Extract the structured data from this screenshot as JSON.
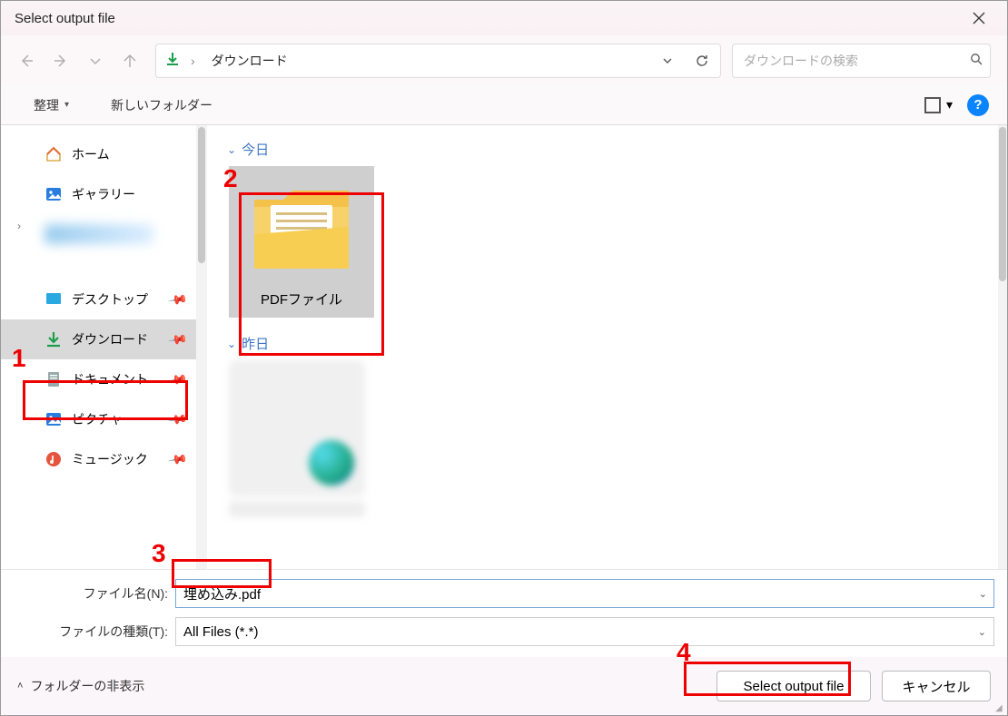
{
  "title": "Select output file",
  "nav": {
    "crumb": "ダウンロード"
  },
  "search": {
    "placeholder": "ダウンロードの検索"
  },
  "toolbar": {
    "organize": "整理",
    "newfolder": "新しいフォルダー"
  },
  "sidebar": {
    "home": "ホーム",
    "gallery": "ギャラリー",
    "desktop": "デスクトップ",
    "downloads": "ダウンロード",
    "documents": "ドキュメント",
    "pictures": "ピクチャ",
    "music": "ミュージック"
  },
  "groups": {
    "today": "今日",
    "yesterday": "昨日"
  },
  "items": {
    "pdffolder": "PDFファイル"
  },
  "fields": {
    "filename_label": "ファイル名(N):",
    "filetype_label": "ファイルの種類(T):",
    "filename_value": "埋め込み.pdf",
    "filetype_value": "All Files (*.*)"
  },
  "footer": {
    "hide_folders": "フォルダーの非表示",
    "select": "Select output file",
    "cancel": "キャンセル"
  },
  "annotations": {
    "n1": "1",
    "n2": "2",
    "n3": "3",
    "n4": "4"
  }
}
